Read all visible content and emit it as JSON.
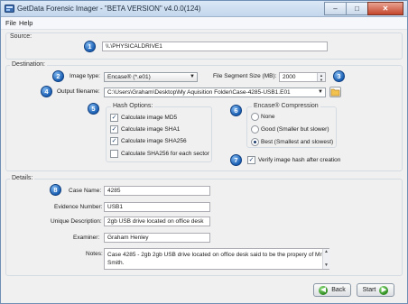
{
  "window": {
    "title": "GetData Forensic Imager - \"BETA VERSION\" v4.0.0(124)",
    "minimize": "–",
    "maximize": "□",
    "close": "✕"
  },
  "menu": {
    "file": "File",
    "help": "Help"
  },
  "source": {
    "group_title": "Source:",
    "badge": "1",
    "value": "\\\\.\\PHYSICALDRIVE1"
  },
  "destination": {
    "group_title": "Destination:",
    "image_type": {
      "badge": "2",
      "label": "Image type:",
      "value": "Encase® (*.e01)"
    },
    "segment": {
      "badge": "3",
      "label": "File Segment Size (MB):",
      "value": "2000"
    },
    "output": {
      "badge": "4",
      "label": "Output filename:",
      "value": "C:\\Users\\Graham\\Desktop\\My Aquisition Folder\\Case-4285-USB1.E01"
    },
    "hash": {
      "badge": "5",
      "title": "Hash Options:",
      "options": [
        {
          "label": "Calculate image MD5",
          "checked": true,
          "mark": "✓"
        },
        {
          "label": "Calculate image SHA1",
          "checked": true,
          "mark": "✓"
        },
        {
          "label": "Calculate image SHA256",
          "checked": true,
          "mark": "✓"
        },
        {
          "label": "Calculate SHA256 for each sector",
          "checked": false,
          "mark": ""
        }
      ]
    },
    "compression": {
      "badge": "6",
      "title": "Encase® Compression",
      "options": [
        {
          "label": "None",
          "selected": false
        },
        {
          "label": "Good (Smaller but slower)",
          "selected": false
        },
        {
          "label": "Best (Smallest and slowest)",
          "selected": true
        }
      ]
    },
    "verify": {
      "badge": "7",
      "label": "Verify image hash after creation",
      "checked": true,
      "mark": "✓"
    }
  },
  "details": {
    "group_title": "Details:",
    "badge": "8",
    "case_name": {
      "label": "Case Name:",
      "value": "4285"
    },
    "evidence_number": {
      "label": "Evidence Number:",
      "value": "USB1"
    },
    "unique_description": {
      "label": "Unique Description:",
      "value": "2gb USB drive located on office desk"
    },
    "examiner": {
      "label": "Examiner:",
      "value": "Graham Henley"
    },
    "notes": {
      "label": "Notes:",
      "value": "Case 4285 - 2gb 2gb USB drive located on office desk said to be the propery of Mr Smith."
    }
  },
  "footer": {
    "back": "Back",
    "start": "Start"
  },
  "colors": {
    "badge": "#1b5fb3",
    "start_arrow": "#2c8a1d",
    "back_arrow": "#2c8a1d",
    "title_bar": "#c3d6ec"
  }
}
